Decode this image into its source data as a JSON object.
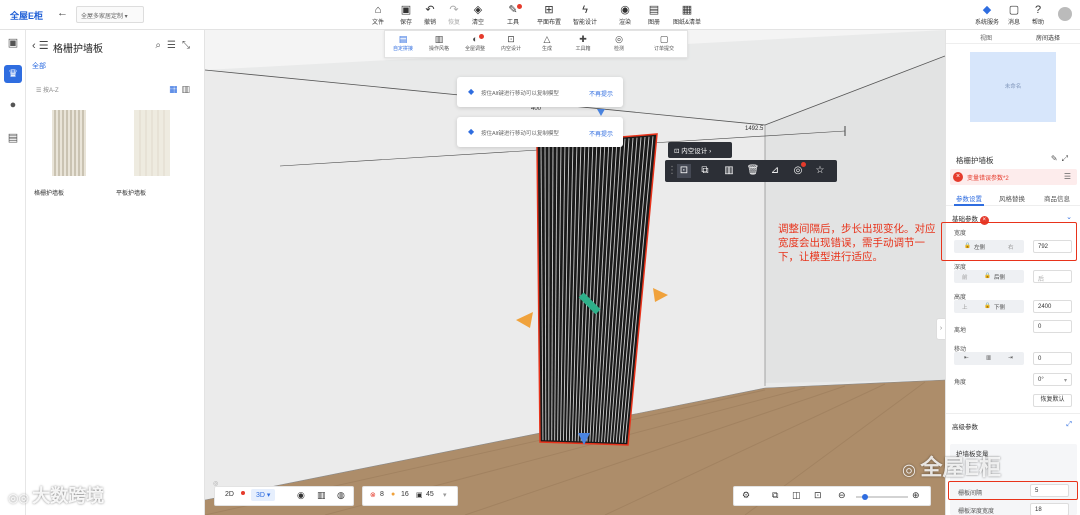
{
  "app": {
    "logo": "全屋E柜",
    "project": "全屋多家居定制"
  },
  "toolbar": {
    "items": [
      "文件",
      "保存",
      "撤销",
      "恢复",
      "清空",
      "工具",
      "平面布置",
      "智能设计",
      "渲染",
      "图册",
      "图纸&清单"
    ],
    "right": [
      "系统服务",
      "消息",
      "帮助"
    ]
  },
  "subtoolbar": {
    "items": [
      "自定拼接",
      "操作风格",
      "全屋调整",
      "内空设计",
      "生成",
      "工具箱",
      "检测",
      "订单提交"
    ]
  },
  "leftnav": {
    "icons": [
      "box-icon",
      "crown-icon",
      "user-icon",
      "cabinet-icon"
    ]
  },
  "library": {
    "title": "格栅护墙板",
    "category": "全部",
    "sort": "按A-Z",
    "items": [
      {
        "label": "格栅护墙板"
      },
      {
        "label": "平板护墙板"
      }
    ]
  },
  "notices": [
    {
      "message": "按住Alt键进行移动可以复制模型",
      "dismiss": "不再提示"
    },
    {
      "message": "按住Alt键进行移动可以复制模型",
      "dismiss": "不再提示"
    }
  ],
  "dimensions": {
    "top": "400",
    "right": "1492.5"
  },
  "panel_toolbar": {
    "inner_design": "内空设计"
  },
  "annotation": "调整间隔后，步长出现变化。对应宽度会出现错误，需手动调节一下，让模型进行适应。",
  "bottom": {
    "view2d": "2D",
    "view3d": "3D",
    "errors": "8",
    "warnings": "16",
    "count": "45"
  },
  "right_panel": {
    "tabs": [
      "视图",
      "房间选择"
    ],
    "room_label": "未命名",
    "header": "格栅护墙板",
    "warning": "变量错误参数*2",
    "param_tabs": [
      "参数设置",
      "风格替换",
      "商品信息"
    ],
    "basic_params": "基础参数",
    "width_label": "宽度",
    "width_lock": "左侧",
    "width_mid": "右",
    "width_value": "792",
    "depth_label": "深度",
    "depth_lock_a": "前",
    "depth_lock": "后侧",
    "depth_mid": "后",
    "height_label": "高度",
    "height_a": "上",
    "height_lock": "下侧",
    "height_value": "2400",
    "ground_label": "离地",
    "ground_value": "0",
    "move_label": "移动",
    "move_value": "0",
    "angle_label": "角度",
    "angle_value": "0°",
    "restore": "恢复默认",
    "advanced": "高级参数",
    "group_title": "护墙板变量",
    "gap_label": "栅板间隔",
    "gap_value": "5",
    "bottom_label": "栅板深度宽度",
    "bottom_value": "18"
  },
  "watermark": {
    "left": "大数跨境",
    "right": "全屋E柜"
  },
  "colors": {
    "accent": "#2f6de0",
    "error": "#e8331b",
    "dark_toolbar": "#2c2f36"
  }
}
